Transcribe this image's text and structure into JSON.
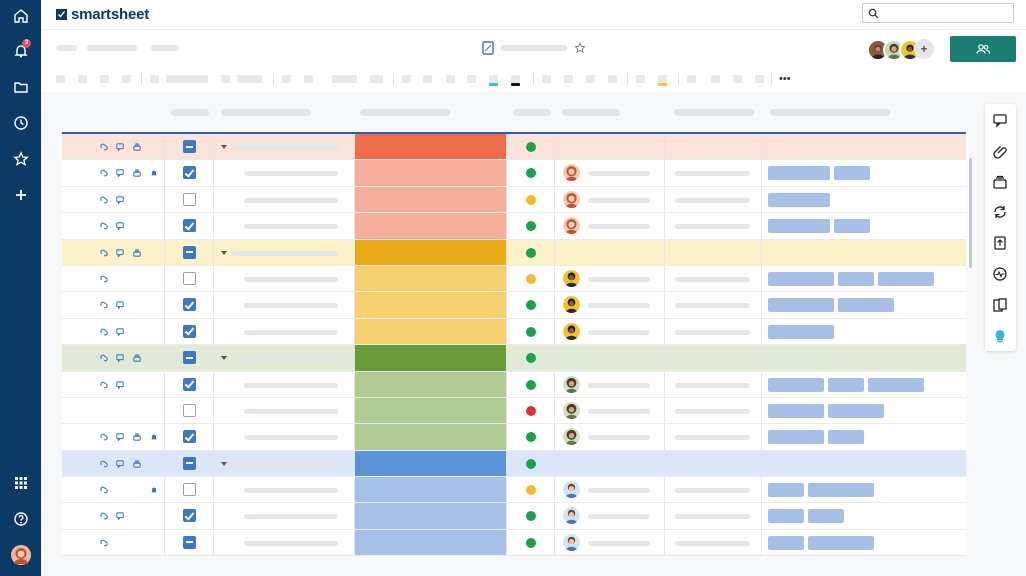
{
  "app": {
    "brand": "smartsheet",
    "notification_count": "3"
  },
  "colors": {
    "nav": "#0b3a66",
    "accent": "#1a7f72",
    "selection": "#2f5ea8",
    "tag": "#a6bfe6",
    "checkbox": "#3c78c3"
  },
  "nav": {
    "top_icons": [
      "home-icon",
      "bell-icon",
      "folder-icon",
      "clock-icon",
      "star-icon",
      "plus-icon"
    ],
    "bottom_icons": [
      "apps-grid-icon",
      "help-icon",
      "user-avatar"
    ]
  },
  "right_panel": {
    "icons": [
      "comment-icon",
      "attachment-icon",
      "proofing-icon",
      "update-requests-icon",
      "upload-icon",
      "activity-icon",
      "summary-icon",
      "lightbulb-icon"
    ]
  },
  "rows": [
    {
      "type": "parent",
      "group": "red",
      "icons": [
        "link",
        "comment",
        "proof"
      ],
      "checkbox": "ind",
      "status": "green",
      "person": null,
      "tags": []
    },
    {
      "type": "child",
      "group": "red",
      "icons": [
        "link",
        "comment",
        "proof",
        "bell"
      ],
      "checkbox": "on",
      "status": "green",
      "person": "red-hair",
      "tags": [
        62,
        36
      ]
    },
    {
      "type": "child",
      "group": "red",
      "icons": [
        "link",
        "comment"
      ],
      "checkbox": "off",
      "status": "yellow",
      "person": "red-hair",
      "tags": [
        62
      ]
    },
    {
      "type": "child",
      "group": "red",
      "icons": [
        "link",
        "comment"
      ],
      "checkbox": "on",
      "status": "green",
      "person": "red-hair",
      "tags": [
        62,
        36
      ]
    },
    {
      "type": "parent",
      "group": "yellow",
      "icons": [
        "link",
        "comment",
        "proof"
      ],
      "checkbox": "ind",
      "status": "green",
      "person": null,
      "tags": []
    },
    {
      "type": "child",
      "group": "yellow",
      "icons": [
        "link"
      ],
      "checkbox": "off",
      "status": "yellow",
      "person": "dark",
      "tags": [
        66,
        36,
        56
      ]
    },
    {
      "type": "child",
      "group": "yellow",
      "icons": [
        "link",
        "comment"
      ],
      "checkbox": "on",
      "status": "green",
      "person": "dark",
      "tags": [
        66,
        56
      ]
    },
    {
      "type": "child",
      "group": "yellow",
      "icons": [
        "link",
        "comment"
      ],
      "checkbox": "on",
      "status": "green",
      "person": "dark",
      "tags": [
        66
      ]
    },
    {
      "type": "parent",
      "group": "green",
      "icons": [
        "link",
        "comment",
        "proof"
      ],
      "checkbox": "ind",
      "status": "green",
      "person": null,
      "tags": []
    },
    {
      "type": "child",
      "group": "green",
      "icons": [
        "link",
        "comment"
      ],
      "checkbox": "on",
      "status": "green",
      "person": "curly",
      "tags": [
        56,
        36,
        56
      ]
    },
    {
      "type": "child",
      "group": "green",
      "icons": [],
      "checkbox": "off",
      "status": "red",
      "person": "curly",
      "tags": [
        56,
        56
      ]
    },
    {
      "type": "child",
      "group": "green",
      "icons": [
        "link",
        "comment",
        "proof",
        "bell"
      ],
      "checkbox": "on",
      "status": "green",
      "person": "curly",
      "tags": [
        56,
        36
      ]
    },
    {
      "type": "parent",
      "group": "blue",
      "icons": [
        "link",
        "comment",
        "proof"
      ],
      "checkbox": "ind",
      "status": "green",
      "person": null,
      "tags": []
    },
    {
      "type": "child",
      "group": "blue",
      "icons": [
        "link",
        "bell"
      ],
      "checkbox": "off",
      "status": "yellow",
      "person": "light",
      "tags": [
        36,
        66
      ]
    },
    {
      "type": "child",
      "group": "blue",
      "icons": [
        "link",
        "comment"
      ],
      "checkbox": "on",
      "status": "green",
      "person": "light",
      "tags": [
        36,
        36
      ]
    },
    {
      "type": "child",
      "group": "blue",
      "icons": [
        "link"
      ],
      "checkbox": "ind",
      "status": "green",
      "person": "light",
      "tags": [
        36,
        66
      ]
    }
  ],
  "groups": {
    "red": {
      "row_bg": "#fde3da",
      "parent_cell": "#ef6c4a",
      "child_cell": "#f5ae9a"
    },
    "yellow": {
      "row_bg": "#fdf1c9",
      "parent_cell": "#e7aa14",
      "child_cell": "#f4d06e"
    },
    "green": {
      "row_bg": "#e1ead7",
      "parent_cell": "#6a9c38",
      "child_cell": "#b0cb94"
    },
    "blue": {
      "row_bg": "#dbe6f8",
      "parent_cell": "#5b93d8",
      "child_cell": "#a6c0e7"
    }
  },
  "status_colors": {
    "green": "#1aa24b",
    "yellow": "#f5b731",
    "red": "#d2362f"
  }
}
